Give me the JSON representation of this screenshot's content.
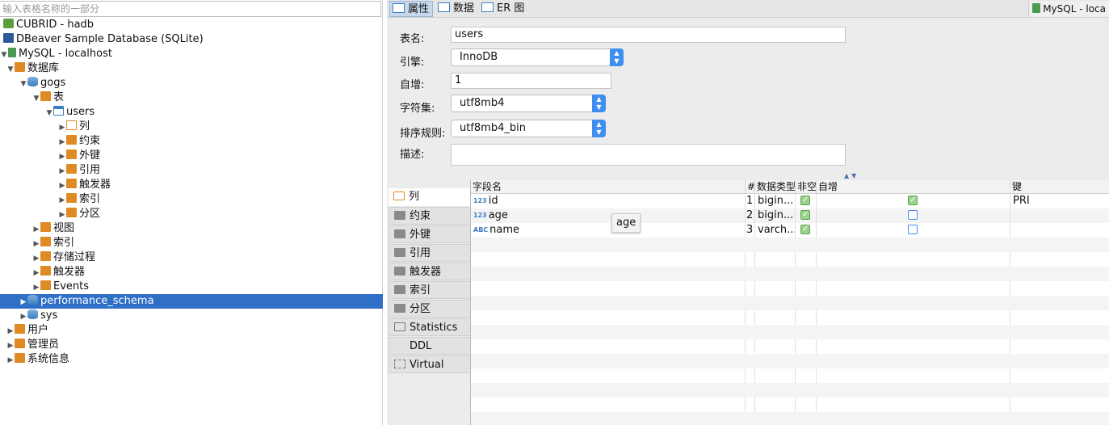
{
  "navigator": {
    "search_placeholder": "输入表格名称的一部分",
    "items": [
      {
        "label": "CUBRID - hadb",
        "icon": "cubrid-icon"
      },
      {
        "label": "DBeaver Sample Database (SQLite)",
        "icon": "sqlite-icon"
      },
      {
        "label": "MySQL - localhost",
        "icon": "mysql-connection-icon"
      },
      {
        "label": "数据库",
        "icon": "databases-folder-icon"
      },
      {
        "label": "gogs",
        "icon": "database-icon"
      },
      {
        "label": "表",
        "icon": "tables-folder-icon"
      },
      {
        "label": "users",
        "icon": "table-icon"
      },
      {
        "label": "列",
        "icon": "columns-icon"
      },
      {
        "label": "约束",
        "icon": "constraints-icon"
      },
      {
        "label": "外键",
        "icon": "folder-icon"
      },
      {
        "label": "引用",
        "icon": "folder-icon"
      },
      {
        "label": "触发器",
        "icon": "folder-icon"
      },
      {
        "label": "索引",
        "icon": "folder-icon"
      },
      {
        "label": "分区",
        "icon": "folder-icon"
      },
      {
        "label": "视图",
        "icon": "views-icon"
      },
      {
        "label": "索引",
        "icon": "folder-icon"
      },
      {
        "label": "存储过程",
        "icon": "folder-icon"
      },
      {
        "label": "触发器",
        "icon": "folder-icon"
      },
      {
        "label": "Events",
        "icon": "folder-icon"
      },
      {
        "label": "performance_schema",
        "icon": "database-icon"
      },
      {
        "label": "sys",
        "icon": "database-icon"
      },
      {
        "label": "用户",
        "icon": "users-icon"
      },
      {
        "label": "管理员",
        "icon": "admin-icon"
      },
      {
        "label": "系统信息",
        "icon": "system-info-icon"
      }
    ]
  },
  "editor": {
    "tabs": [
      {
        "label": "属性",
        "icon": "properties-icon"
      },
      {
        "label": "数据",
        "icon": "data-icon"
      },
      {
        "label": "ER 图",
        "icon": "er-diagram-icon"
      }
    ],
    "connection": "MySQL - loca",
    "properties": {
      "table_name_label": "表名:",
      "table_name": "users",
      "engine_label": "引擎:",
      "engine": "InnoDB",
      "auto_increment_label": "自增:",
      "auto_increment": "1",
      "charset_label": "字符集:",
      "charset": "utf8mb4",
      "collation_label": "排序规则:",
      "collation": "utf8mb4_bin",
      "description_label": "描述:",
      "description": ""
    },
    "sub_tabs": [
      {
        "label": "列",
        "icon": "columns-icon"
      },
      {
        "label": "约束",
        "icon": "constraints-icon"
      },
      {
        "label": "外键",
        "icon": "folder-icon"
      },
      {
        "label": "引用",
        "icon": "folder-icon"
      },
      {
        "label": "触发器",
        "icon": "folder-icon"
      },
      {
        "label": "索引",
        "icon": "folder-icon"
      },
      {
        "label": "分区",
        "icon": "folder-icon"
      },
      {
        "label": "Statistics",
        "icon": "info-icon"
      },
      {
        "label": "DDL",
        "icon": "ddl-icon"
      },
      {
        "label": "Virtual",
        "icon": "virtual-icon"
      }
    ],
    "grid": {
      "headers": [
        "字段名",
        "#",
        "数据类型",
        "非空",
        "自增",
        "键"
      ],
      "rows": [
        {
          "type_badge": "123",
          "name": "id",
          "pos": "1",
          "type": "bigin...",
          "not_null": true,
          "auto_inc": true,
          "key": "PRI"
        },
        {
          "type_badge": "123",
          "name": "age",
          "pos": "2",
          "type": "bigin...",
          "not_null": true,
          "auto_inc": false,
          "key": ""
        },
        {
          "type_badge": "ABC",
          "name": "name",
          "pos": "3",
          "type": "varch...",
          "not_null": true,
          "auto_inc": false,
          "key": ""
        }
      ]
    },
    "tooltip": "age"
  }
}
